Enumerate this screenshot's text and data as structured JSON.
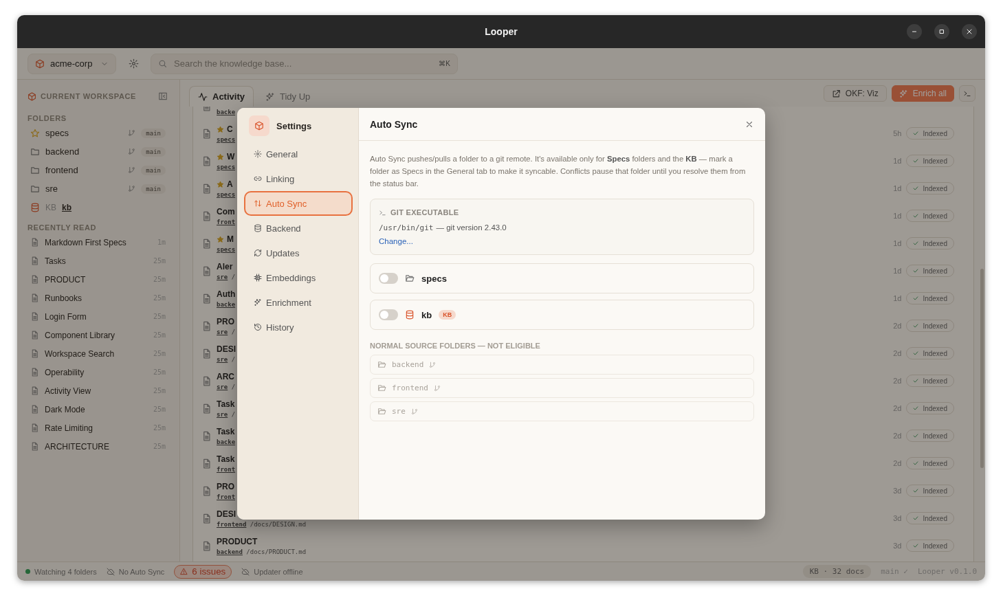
{
  "window": {
    "title": "Looper"
  },
  "toolbar": {
    "workspace": "acme-corp",
    "search": {
      "placeholder": "Search the knowledge base...",
      "shortcut": "⌘K"
    }
  },
  "sidebar": {
    "workspace_heading": "CURRENT WORKSPACE",
    "folders_heading": "FOLDERS",
    "folders": [
      {
        "name": "specs",
        "kind": "specs",
        "branch": "main"
      },
      {
        "name": "backend",
        "kind": "folder",
        "branch": "main"
      },
      {
        "name": "frontend",
        "kind": "folder",
        "branch": "main"
      },
      {
        "name": "sre",
        "kind": "folder",
        "branch": "main"
      },
      {
        "name": "kb",
        "kind": "kb",
        "label": "KB"
      }
    ],
    "recent_heading": "RECENTLY READ",
    "recent": [
      {
        "title": "Markdown First Specs",
        "time": "1m"
      },
      {
        "title": "Tasks",
        "time": "25m"
      },
      {
        "title": "PRODUCT",
        "time": "25m"
      },
      {
        "title": "Runbooks",
        "time": "25m"
      },
      {
        "title": "Login Form",
        "time": "25m"
      },
      {
        "title": "Component Library",
        "time": "25m"
      },
      {
        "title": "Workspace Search",
        "time": "25m"
      },
      {
        "title": "Operability",
        "time": "25m"
      },
      {
        "title": "Activity View",
        "time": "25m"
      },
      {
        "title": "Dark Mode",
        "time": "25m"
      },
      {
        "title": "Rate Limiting",
        "time": "25m"
      },
      {
        "title": "ARCHITECTURE",
        "time": "25m"
      }
    ]
  },
  "tabs": [
    {
      "label": "Activity",
      "selected": true
    },
    {
      "label": "Tidy Up",
      "selected": false
    }
  ],
  "actions": [
    {
      "label": "OKF: Viz",
      "kind": "external"
    },
    {
      "label": "Enrich all",
      "kind": "primary"
    },
    {
      "kind": "terminal"
    }
  ],
  "activity": {
    "rows": [
      {
        "folder": "backe"
      },
      {
        "title": "C",
        "starred": true,
        "folder": "specs",
        "time": "5h",
        "status": "Indexed"
      },
      {
        "title": "W",
        "starred": true,
        "folder": "specs",
        "time": "1d",
        "status": "Indexed"
      },
      {
        "title": "A",
        "starred": true,
        "folder": "specs",
        "time": "1d",
        "status": "Indexed"
      },
      {
        "title": "Com",
        "starred": false,
        "folder": "front",
        "time": "1d",
        "status": "Indexed"
      },
      {
        "title": "M",
        "starred": true,
        "folder": "specs",
        "time": "1d",
        "status": "Indexed"
      },
      {
        "title": "Aler",
        "starred": false,
        "folder": "sre",
        "path": "/",
        "time": "1d",
        "status": "Indexed"
      },
      {
        "title": "Auth",
        "starred": false,
        "folder": "backe",
        "time": "1d",
        "status": "Indexed"
      },
      {
        "title": "PRO",
        "starred": false,
        "folder": "sre",
        "path": "/",
        "time": "2d",
        "status": "Indexed"
      },
      {
        "title": "DESI",
        "starred": false,
        "folder": "sre",
        "path": "/",
        "time": "2d",
        "status": "Indexed"
      },
      {
        "title": "ARC",
        "starred": false,
        "folder": "sre",
        "path": "/",
        "time": "2d",
        "status": "Indexed"
      },
      {
        "title": "Task",
        "starred": false,
        "folder": "sre",
        "path": "/",
        "time": "2d",
        "status": "Indexed"
      },
      {
        "title": "Task",
        "starred": false,
        "folder": "backe",
        "time": "2d",
        "status": "Indexed"
      },
      {
        "title": "Task",
        "starred": false,
        "folder": "front",
        "time": "2d",
        "status": "Indexed"
      },
      {
        "title": "PRO",
        "starred": false,
        "folder": "front",
        "time": "3d",
        "status": "Indexed"
      },
      {
        "title": "DESI",
        "starred": false,
        "folder": "frontend",
        "path": "/docs/DESIGN.md",
        "time": "3d",
        "status": "Indexed"
      },
      {
        "title": "PRODUCT",
        "starred": false,
        "folder": "backend",
        "path": "/docs/PRODUCT.md",
        "time": "3d",
        "status": "Indexed"
      }
    ]
  },
  "settings_dialog": {
    "title": "Settings",
    "nav": [
      {
        "label": "General",
        "selected": false
      },
      {
        "label": "Linking",
        "selected": false
      },
      {
        "label": "Auto Sync",
        "selected": true
      },
      {
        "label": "Backend",
        "selected": false
      },
      {
        "label": "Updates",
        "selected": false
      },
      {
        "label": "Embeddings",
        "selected": false
      },
      {
        "label": "Enrichment",
        "selected": false
      },
      {
        "label": "History",
        "selected": false
      }
    ],
    "page": {
      "title": "Auto Sync",
      "description": "Auto Sync pushes/pulls a folder to a git remote. It's available only for **Specs** folders and the **KB** — mark a folder as Specs in the General tab to make it syncable. Conflicts pause that folder until you resolve them from the status bar.",
      "git": {
        "heading": "GIT EXECUTABLE",
        "path": "/usr/bin/git",
        "version": "— git version 2.43.0",
        "action": "Change..."
      },
      "sync_folders": [
        {
          "name": "specs",
          "kind": "folder",
          "on": false
        },
        {
          "name": "kb",
          "kind": "kb",
          "badge": "KB",
          "on": false
        }
      ],
      "ineligible_heading": "NORMAL SOURCE FOLDERS — NOT ELIGIBLE",
      "ineligible": [
        {
          "name": "backend"
        },
        {
          "name": "frontend"
        },
        {
          "name": "sre"
        }
      ]
    }
  },
  "status_bar": {
    "left": [
      {
        "kind": "watching",
        "label": "Watching 4 folders"
      },
      {
        "kind": "sync-off",
        "label": "No Auto Sync"
      },
      {
        "kind": "issues",
        "label": "6 issues"
      },
      {
        "kind": "updater-off",
        "label": "Updater offline"
      }
    ],
    "kb": "KB · 32 docs",
    "branch": "main ✓",
    "version": "Looper v0.1.0"
  }
}
